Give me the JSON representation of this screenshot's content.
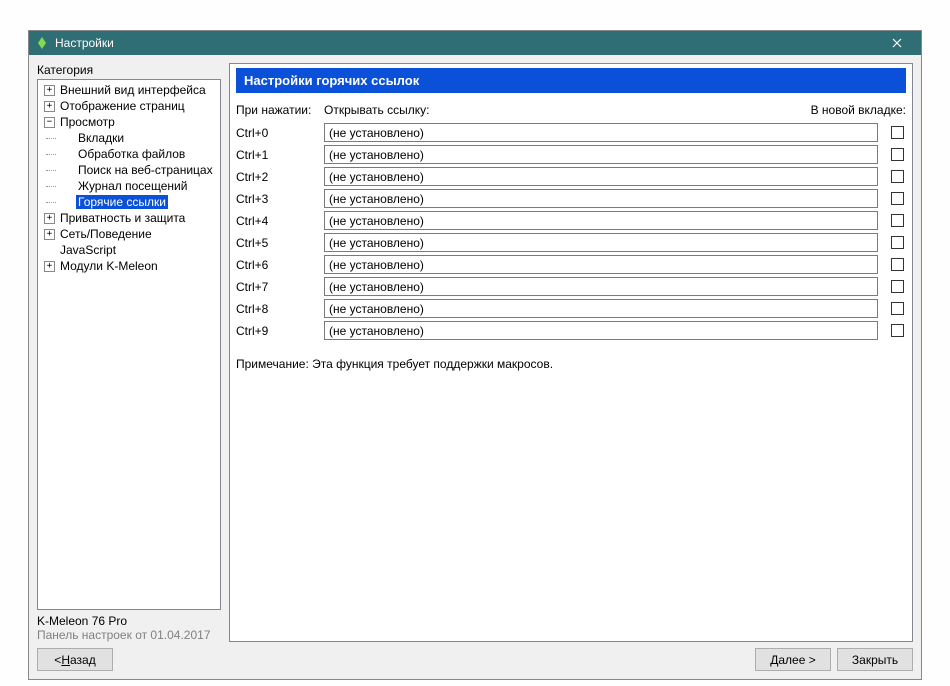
{
  "window": {
    "title": "Настройки"
  },
  "sidebar": {
    "category_label": "Категория",
    "nodes": {
      "appearance": "Внешний вид интерфейса",
      "rendering": "Отображение страниц",
      "browsing": "Просмотр",
      "tabs": "Вкладки",
      "filehandling": "Обработка файлов",
      "findinpage": "Поиск на веб-страницах",
      "history": "Журнал посещений",
      "hotlinks": "Горячие ссылки",
      "privacy": "Приватность и защита",
      "network": "Сеть/Поведение",
      "javascript": "JavaScript",
      "modules": "Модули K-Meleon"
    },
    "version": "K-Meleon 76 Pro",
    "panel_date": "Панель настроек от 01.04.2017"
  },
  "content": {
    "title": "Настройки горячих ссылок",
    "col_press": "При нажатии:",
    "col_open": "Открывать ссылку:",
    "col_newtab": "В новой вкладке:",
    "placeholder": "(не установлено)",
    "rows": [
      {
        "key": "Ctrl+0"
      },
      {
        "key": "Ctrl+1"
      },
      {
        "key": "Ctrl+2"
      },
      {
        "key": "Ctrl+3"
      },
      {
        "key": "Ctrl+4"
      },
      {
        "key": "Ctrl+5"
      },
      {
        "key": "Ctrl+6"
      },
      {
        "key": "Ctrl+7"
      },
      {
        "key": "Ctrl+8"
      },
      {
        "key": "Ctrl+9"
      }
    ],
    "note": "Примечание: Эта функция требует поддержки макросов."
  },
  "buttons": {
    "back_pre": "< ",
    "back_u": "Н",
    "back_post": "азад",
    "next_pre": "",
    "next_u": "Д",
    "next_post": "алее >",
    "close": "Закрыть"
  }
}
